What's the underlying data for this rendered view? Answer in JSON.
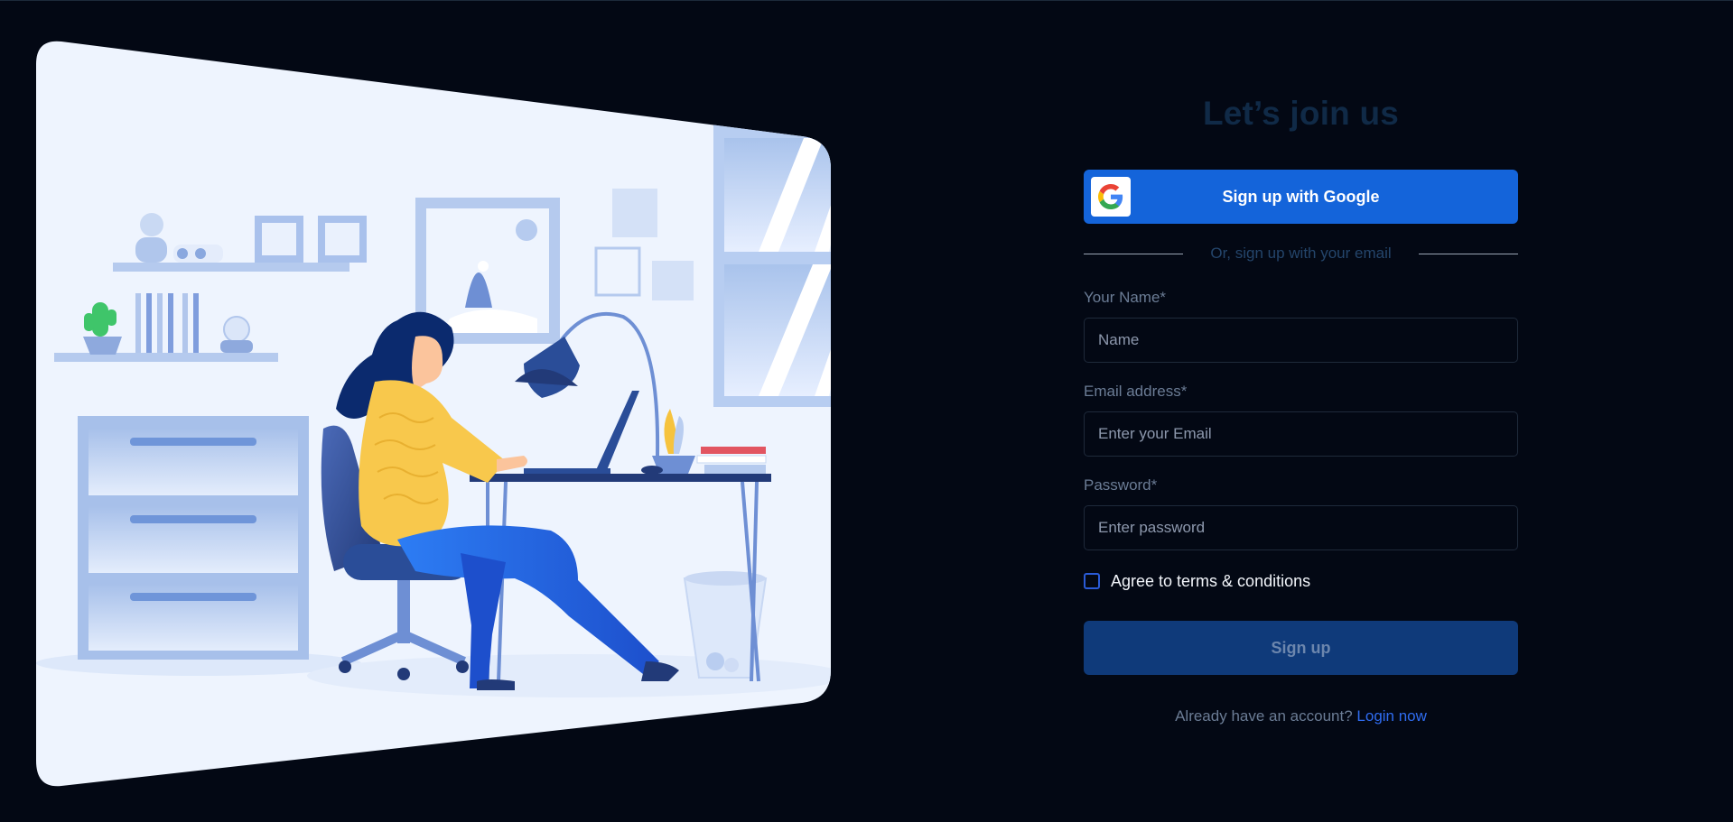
{
  "form": {
    "title": "Let’s join us",
    "google_button_label": "Sign up with Google",
    "divider_text": "Or, sign up with your email",
    "name_label": "Your Name*",
    "name_placeholder": "Name",
    "email_label": "Email address*",
    "email_placeholder": "Enter your Email",
    "password_label": "Password*",
    "password_placeholder": "Enter password",
    "terms_label": "Agree to terms & conditions",
    "terms_checked": false,
    "signup_button_label": "Sign up",
    "footer_text": "Already have an account?",
    "login_link": "Login now"
  },
  "icons": {
    "google": "google-logo-icon",
    "illustration": "woman-working-at-desk-illustration"
  },
  "colors": {
    "background": "#030814",
    "google_button": "#1464da",
    "signup_button": "#0f3a7a",
    "link": "#2f6cf0",
    "title": "#102a47"
  }
}
